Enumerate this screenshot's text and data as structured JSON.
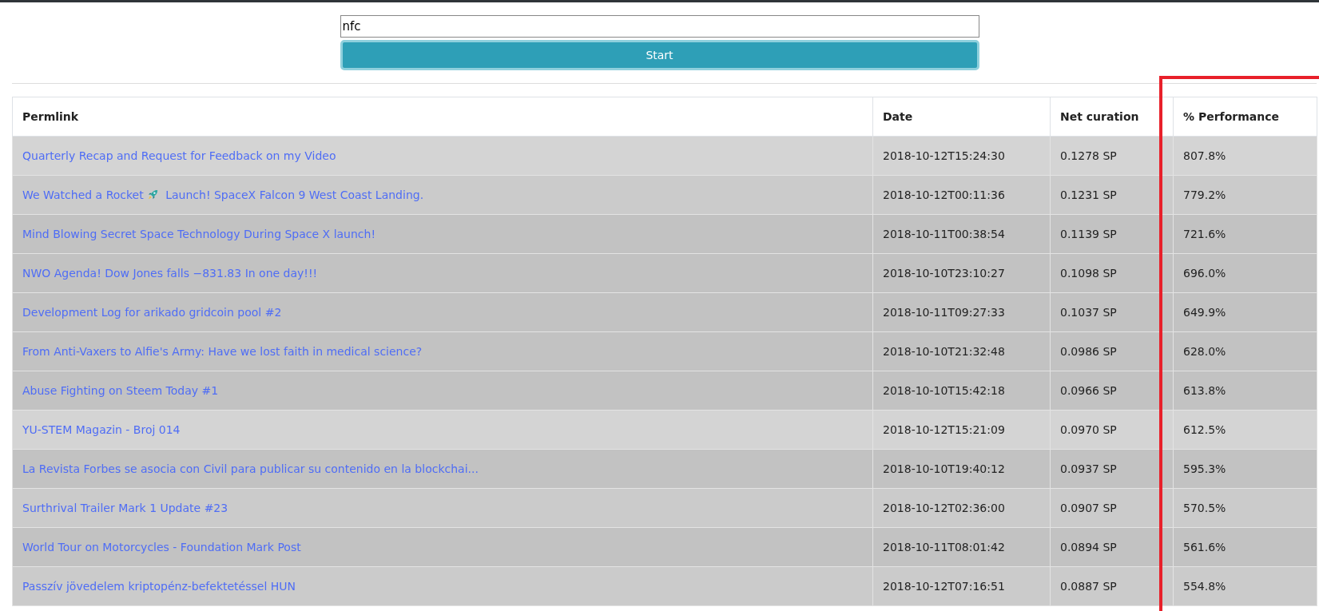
{
  "search": {
    "value": "nfc"
  },
  "start_button": "Start",
  "table": {
    "columns": [
      "Permlink",
      "Date",
      "Net curation",
      "% Performance"
    ],
    "rows": [
      {
        "permlink": "Quarterly Recap and Request for Feedback on my Video",
        "date": "2018-10-12T15:24:30",
        "net_curation": "0.1278 SP",
        "performance": "807.8%",
        "color": "#d4d4d4"
      },
      {
        "permlink": "We Watched a Rocket",
        "permlink_rest": "Launch! SpaceX Falcon 9 West Coast Landing.",
        "date": "2018-10-12T00:11:36",
        "net_curation": "0.1231 SP",
        "performance": "779.2%",
        "color": "#cbcbcb"
      },
      {
        "permlink": "Mind Blowing Secret Space Technology During Space X launch!",
        "date": "2018-10-11T00:38:54",
        "net_curation": "0.1139 SP",
        "performance": "721.6%",
        "color": "#c2c2c2"
      },
      {
        "permlink": "NWO Agenda! Dow Jones falls −831.83 In one day!!!",
        "date": "2018-10-10T23:10:27",
        "net_curation": "0.1098 SP",
        "performance": "696.0%",
        "color": "#c2c2c2"
      },
      {
        "permlink": "Development Log for arikado gridcoin pool #2",
        "date": "2018-10-11T09:27:33",
        "net_curation": "0.1037 SP",
        "performance": "649.9%",
        "color": "#c2c2c2"
      },
      {
        "permlink": "From Anti-Vaxers to Alfie's Army: Have we lost faith in medical science?",
        "date": "2018-10-10T21:32:48",
        "net_curation": "0.0986 SP",
        "performance": "628.0%",
        "color": "#c2c2c2"
      },
      {
        "permlink": "Abuse Fighting on Steem Today #1",
        "date": "2018-10-10T15:42:18",
        "net_curation": "0.0966 SP",
        "performance": "613.8%",
        "color": "#c2c2c2"
      },
      {
        "permlink": "YU-STEM Magazin - Broj 014",
        "date": "2018-10-12T15:21:09",
        "net_curation": "0.0970 SP",
        "performance": "612.5%",
        "color": "#d4d4d4"
      },
      {
        "permlink": "La Revista Forbes se asocia con Civil para publicar su contenido en la blockchai...",
        "date": "2018-10-10T19:40:12",
        "net_curation": "0.0937 SP",
        "performance": "595.3%",
        "color": "#c2c2c2"
      },
      {
        "permlink": "Surthrival Trailer Mark 1 Update #23",
        "date": "2018-10-12T02:36:00",
        "net_curation": "0.0907 SP",
        "performance": "570.5%",
        "color": "#cbcbcb"
      },
      {
        "permlink": "World Tour on Motorcycles - Foundation Mark Post",
        "date": "2018-10-11T08:01:42",
        "net_curation": "0.0894 SP",
        "performance": "561.6%",
        "color": "#c2c2c2"
      },
      {
        "permlink": "Passzív jövedelem kriptopénz-befektetéssel HUN",
        "date": "2018-10-12T07:16:51",
        "net_curation": "0.0887 SP",
        "performance": "554.8%",
        "color": "#cbcbcb"
      }
    ]
  }
}
